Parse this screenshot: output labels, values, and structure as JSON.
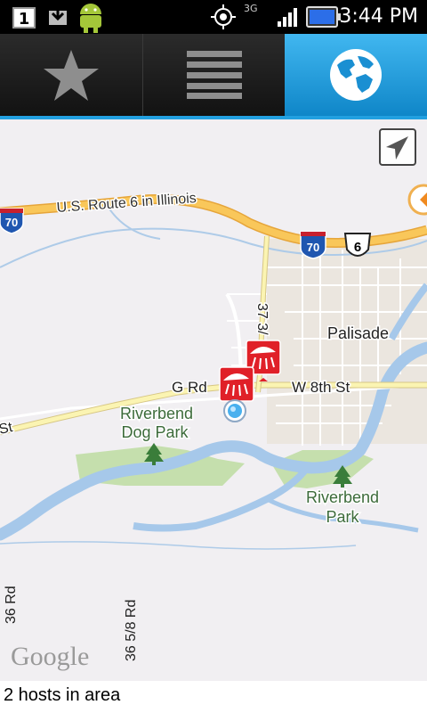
{
  "status_bar": {
    "notification_count": "1",
    "network": "3G",
    "time": "3:44 PM"
  },
  "tabs": [
    {
      "name": "favorites",
      "icon": "star-icon",
      "selected": false
    },
    {
      "name": "list",
      "icon": "list-icon",
      "selected": false
    },
    {
      "name": "map",
      "icon": "globe-icon",
      "selected": true
    }
  ],
  "map": {
    "roads": {
      "us6_name": "U.S. Route 6 in Illinois",
      "i70_shield_1": "70",
      "i70_shield_2": "70",
      "us6_shield": "6",
      "g_rd": "G Rd",
      "w_8th_st": "W 8th St",
      "st_partial": "St",
      "rd_37": "37 3/",
      "rd_36": "36 Rd",
      "rd_36_5_8": "36 5/8 Rd"
    },
    "places": {
      "palisade": "Palisade",
      "dog_park_line1": "Riverbend",
      "dog_park_line2": "Dog Park",
      "park_line1": "Riverbend",
      "park_line2": "Park"
    },
    "attribution": "Google",
    "markers": [
      {
        "type": "host-marker",
        "icon": "shower-icon"
      },
      {
        "type": "host-marker",
        "icon": "shower-icon"
      }
    ],
    "current_location": "location-dot"
  },
  "footer": {
    "status_text": "2 hosts in area"
  }
}
